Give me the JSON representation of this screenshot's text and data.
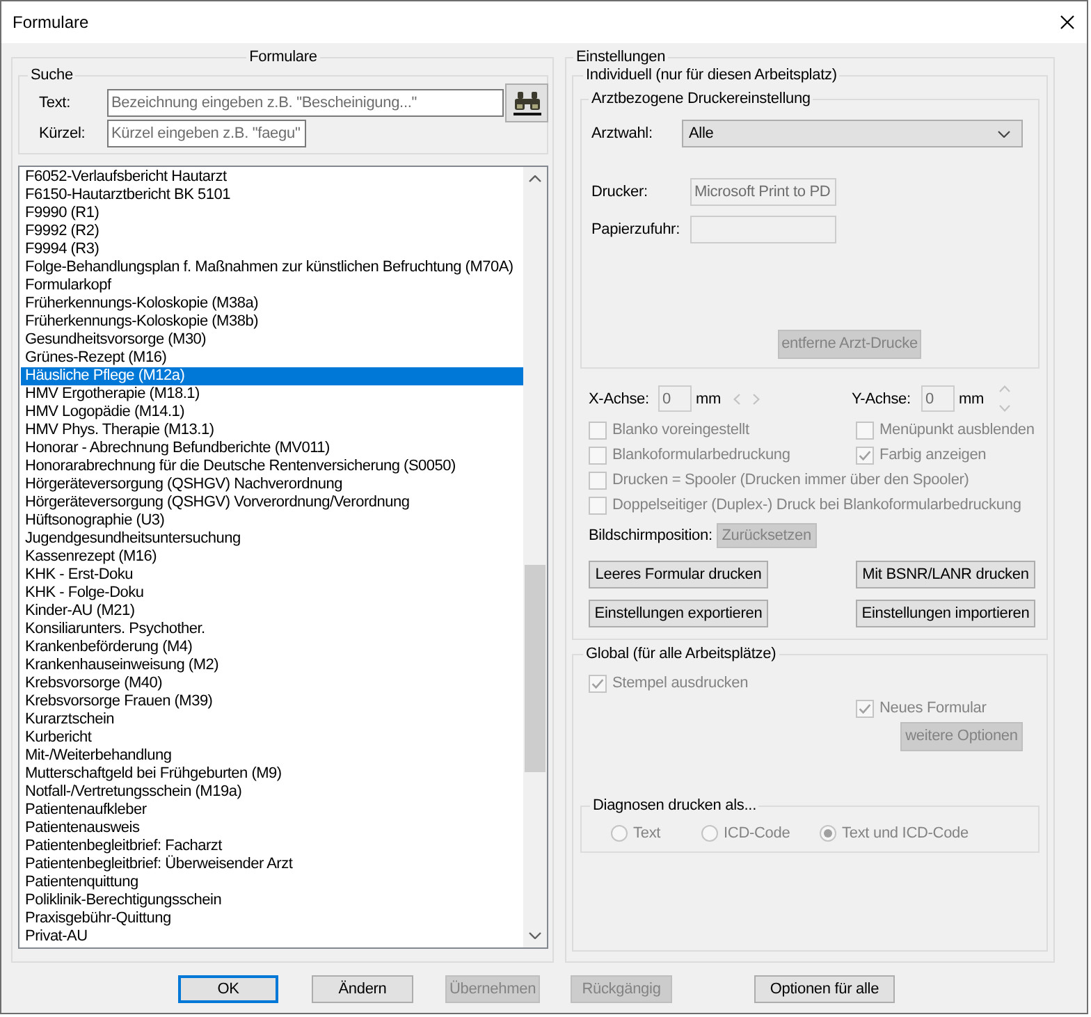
{
  "window": {
    "title": "Formulare"
  },
  "forms": {
    "title": "Formulare",
    "search": {
      "title": "Suche",
      "fields": [
        {
          "label": "Text:",
          "placeholder": "Bezeichnung eingeben z.B. \"Bescheinigung...\""
        },
        {
          "label": "Kürzel:",
          "placeholder": "Kürzel eingeben z.B. \"faegu\""
        }
      ]
    },
    "list": {
      "items": [
        {
          "label": "F6052-Verlaufsbericht Hautarzt",
          "selected": false
        },
        {
          "label": "F6150-Hautarztbericht BK 5101",
          "selected": false
        },
        {
          "label": "F9990 (R1)",
          "selected": false
        },
        {
          "label": "F9992 (R2)",
          "selected": false
        },
        {
          "label": "F9994 (R3)",
          "selected": false
        },
        {
          "label": "Folge-Behandlungsplan f. Maßnahmen zur künstlichen Befruchtung (M70A)",
          "selected": false
        },
        {
          "label": "Formularkopf",
          "selected": false
        },
        {
          "label": "Früherkennungs-Koloskopie (M38a)",
          "selected": false
        },
        {
          "label": "Früherkennungs-Koloskopie (M38b)",
          "selected": false
        },
        {
          "label": "Gesundheitsvorsorge (M30)",
          "selected": false
        },
        {
          "label": "Grünes-Rezept (M16)",
          "selected": false
        },
        {
          "label": "Häusliche Pflege (M12a)",
          "selected": true
        },
        {
          "label": "HMV Ergotherapie (M18.1)",
          "selected": false
        },
        {
          "label": "HMV Logopädie (M14.1)",
          "selected": false
        },
        {
          "label": "HMV Phys. Therapie (M13.1)",
          "selected": false
        },
        {
          "label": "Honorar - Abrechnung Befundberichte (MV011)",
          "selected": false
        },
        {
          "label": "Honorarabrechnung für die Deutsche Rentenversicherung (S0050)",
          "selected": false
        },
        {
          "label": "Hörgeräteversorgung (QSHGV) Nachverordnung",
          "selected": false
        },
        {
          "label": "Hörgeräteversorgung (QSHGV) Vorverordnung/Verordnung",
          "selected": false
        },
        {
          "label": "Hüftsonographie (U3)",
          "selected": false
        },
        {
          "label": "Jugendgesundheitsuntersuchung",
          "selected": false
        },
        {
          "label": "Kassenrezept (M16)",
          "selected": false
        },
        {
          "label": "KHK - Erst-Doku",
          "selected": false
        },
        {
          "label": "KHK - Folge-Doku",
          "selected": false
        },
        {
          "label": "Kinder-AU (M21)",
          "selected": false
        },
        {
          "label": "Konsiliarunters. Psychother.",
          "selected": false
        },
        {
          "label": "Krankenbeförderung (M4)",
          "selected": false
        },
        {
          "label": "Krankenhauseinweisung (M2)",
          "selected": false
        },
        {
          "label": "Krebsvorsorge (M40)",
          "selected": false
        },
        {
          "label": "Krebsvorsorge Frauen (M39)",
          "selected": false
        },
        {
          "label": "Kurarztschein",
          "selected": false
        },
        {
          "label": "Kurbericht",
          "selected": false
        },
        {
          "label": "Mit-/Weiterbehandlung",
          "selected": false
        },
        {
          "label": "Mutterschaftgeld bei Frühgeburten (M9)",
          "selected": false
        },
        {
          "label": "Notfall-/Vertretungsschein (M19a)",
          "selected": false
        },
        {
          "label": "Patientenaufkleber",
          "selected": false
        },
        {
          "label": "Patientenausweis",
          "selected": false
        },
        {
          "label": "Patientenbegleitbrief: Facharzt",
          "selected": false
        },
        {
          "label": "Patientenbegleitbrief: Überweisender Arzt",
          "selected": false
        },
        {
          "label": "Patientenquittung",
          "selected": false
        },
        {
          "label": "Poliklinik-Berechtigungsschein",
          "selected": false
        },
        {
          "label": "Praxisgebühr-Quittung",
          "selected": false
        },
        {
          "label": "Privat-AU",
          "selected": false
        }
      ]
    }
  },
  "settings": {
    "title": "Einstellungen",
    "individual": {
      "title": "Individuell (nur für diesen Arbeitsplatz)",
      "printer_settings": {
        "title": "Arztbezogene Druckereinstellung",
        "doctor_select": {
          "label": "Arztwahl:",
          "value": "Alle"
        },
        "fields": [
          {
            "label": "Drucker:",
            "value": "Microsoft Print to PD",
            "disabled": true
          },
          {
            "label": "Papierzufuhr:",
            "disabled": true
          }
        ],
        "remove_button": {
          "label": "entferne Arzt-Drucke",
          "disabled": true
        }
      },
      "offsets": [
        {
          "label": "X-Achse:",
          "value": "0",
          "unit": "mm",
          "kind": "horizontal",
          "disabled": true
        },
        {
          "label": "Y-Achse:",
          "value": "0",
          "unit": "mm",
          "kind": "vertical",
          "disabled": true
        }
      ],
      "checkbox_rows": [
        [
          {
            "label": "Blanko voreingestellt",
            "checked": false,
            "disabled": true
          },
          {
            "label": "Menüpunkt ausblenden",
            "checked": false,
            "disabled": true
          }
        ],
        [
          {
            "label": "Blankoformularbedruckung",
            "checked": false,
            "disabled": true
          },
          {
            "label": "Farbig anzeigen",
            "checked": true,
            "disabled": true
          }
        ],
        [
          {
            "label": "Drucken = Spooler (Drucken immer über den Spooler)",
            "checked": false,
            "disabled": true
          }
        ],
        [
          {
            "label": "Doppelseitiger (Duplex-) Druck bei Blankoformularbedruckung",
            "checked": false,
            "disabled": true
          }
        ]
      ],
      "screen_position": {
        "label": "Bildschirmposition:",
        "button": {
          "label": "Zurücksetzen",
          "disabled": true
        }
      },
      "button_rows": [
        [
          {
            "label": "Leeres Formular drucken",
            "disabled": false
          },
          {
            "label": "Mit BSNR/LANR drucken",
            "disabled": false
          }
        ],
        [
          {
            "label": "Einstellungen exportieren",
            "disabled": false
          },
          {
            "label": "Einstellungen importieren",
            "disabled": false
          }
        ]
      ]
    },
    "global": {
      "title": "Global (für alle Arbeitsplätze)",
      "stamp_checkbox": {
        "label": "Stempel ausdrucken",
        "checked": true,
        "disabled": true
      },
      "new_form_checkbox": {
        "label": "Neues Formular",
        "checked": true,
        "disabled": true
      },
      "more_options_button": {
        "label": "weitere Optionen",
        "disabled": true
      },
      "diagnoses": {
        "title": "Diagnosen drucken als...",
        "options": [
          {
            "label": "Text",
            "selected": false,
            "disabled": true
          },
          {
            "label": "ICD-Code",
            "selected": false,
            "disabled": true
          },
          {
            "label": "Text und ICD-Code",
            "selected": true,
            "disabled": true
          }
        ]
      }
    }
  },
  "buttons": [
    {
      "label": "OK",
      "default": true,
      "disabled": false
    },
    {
      "label": "Ändern",
      "default": false,
      "disabled": false
    },
    {
      "label": "Übernehmen",
      "default": false,
      "disabled": true
    },
    {
      "label": "Rückgängig",
      "default": false,
      "disabled": true
    },
    {
      "label": "Optionen für alle",
      "default": false,
      "disabled": false
    }
  ]
}
